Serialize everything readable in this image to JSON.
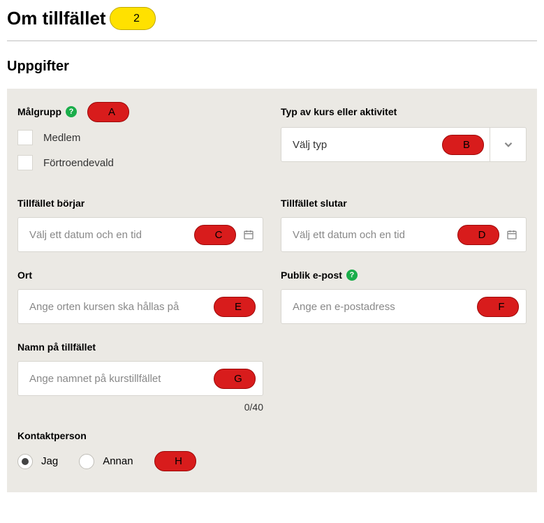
{
  "header": {
    "title": "Om tillfället",
    "step_number": "2"
  },
  "section": {
    "title": "Uppgifter"
  },
  "labels": {
    "malgrupp": "Målgrupp",
    "typ": "Typ av kurs eller aktivitet",
    "borjar": "Tillfället börjar",
    "slutar": "Tillfället slutar",
    "ort": "Ort",
    "epost": "Publik e-post",
    "namn": "Namn på tillfället",
    "kontaktperson": "Kontaktperson"
  },
  "malgrupp_options": {
    "medlem": "Medlem",
    "fortroendevald": "Förtroendevald"
  },
  "typ_select": {
    "value": "Välj typ"
  },
  "placeholders": {
    "borjar": "Välj ett datum och en tid",
    "slutar": "Välj ett datum och en tid",
    "ort": "Ange orten kursen ska hållas på",
    "epost": "Ange en e-postadress",
    "namn": "Ange namnet på kurstillfället"
  },
  "namn_count": "0/40",
  "kontakt": {
    "jag": "Jag",
    "annan": "Annan"
  },
  "markers": {
    "A": "A",
    "B": "B",
    "C": "C",
    "D": "D",
    "E": "E",
    "F": "F",
    "G": "G",
    "H": "H"
  }
}
